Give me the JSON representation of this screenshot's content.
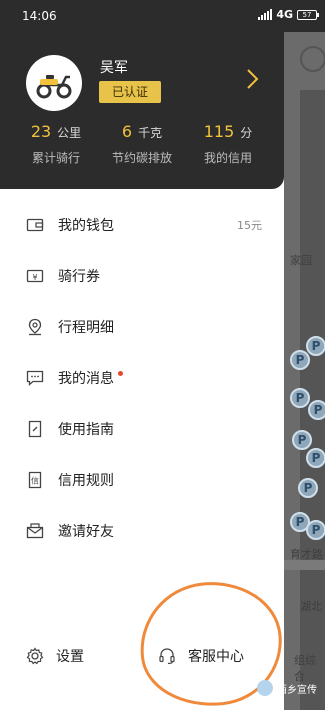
{
  "status_bar": {
    "time": "14:06",
    "network": "4G",
    "battery": "57"
  },
  "profile": {
    "name": "吴军",
    "badge": "已认证"
  },
  "stats": [
    {
      "value": "23",
      "unit": "公里",
      "caption": "累计骑行"
    },
    {
      "value": "6",
      "unit": "千克",
      "caption": "节约碳排放"
    },
    {
      "value": "115",
      "unit": "分",
      "caption": "我的信用"
    }
  ],
  "menu": [
    {
      "label": "我的钱包",
      "extra": "15元",
      "icon": "wallet-icon"
    },
    {
      "label": "骑行券",
      "icon": "ticket-icon"
    },
    {
      "label": "行程明细",
      "icon": "location-pin-icon"
    },
    {
      "label": "我的消息",
      "icon": "message-icon",
      "unread": true
    },
    {
      "label": "使用指南",
      "icon": "guide-book-icon"
    },
    {
      "label": "信用规则",
      "icon": "credit-rules-icon"
    },
    {
      "label": "邀请好友",
      "icon": "invite-mail-icon"
    }
  ],
  "bottom": {
    "settings": "设置",
    "support": "客服中心"
  },
  "map_labels": [
    "家园",
    "育才路",
    "湖北",
    "组综合"
  ],
  "watermark": "西乡宣传",
  "colors": {
    "accent": "#f2c23d",
    "header": "#2c2c2c",
    "annotation": "#ef8a3c",
    "unread_dot": "#e8482c"
  }
}
